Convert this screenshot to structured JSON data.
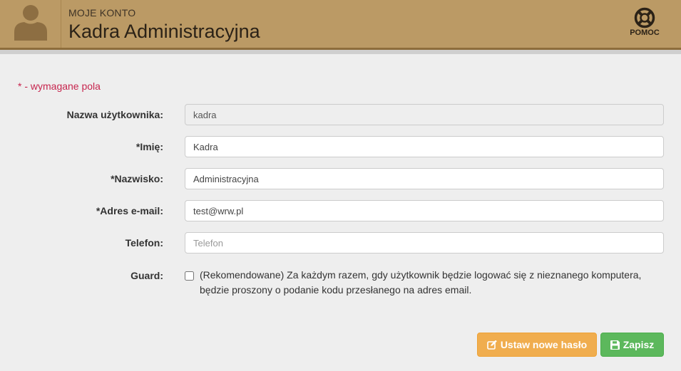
{
  "header": {
    "subtitle": "MOJE KONTO",
    "title": "Kadra Administracyjna",
    "help_label": "POMOC",
    "avatar_icon": "user-silhouette-icon",
    "help_icon": "lifebuoy-icon",
    "background_color": "#bb9a65"
  },
  "form": {
    "required_note": "* - wymagane pola",
    "username": {
      "label": "Nazwa użytkownika:",
      "value": "kadra",
      "readonly": true
    },
    "first_name": {
      "label": "*Imię:",
      "value": "Kadra"
    },
    "last_name": {
      "label": "*Nazwisko:",
      "value": "Administracyjna"
    },
    "email": {
      "label": "*Adres e-mail:",
      "value": "test@wrw.pl"
    },
    "phone": {
      "label": "Telefon:",
      "value": "",
      "placeholder": "Telefon"
    },
    "guard": {
      "label": "Guard:",
      "checked": false,
      "description": "(Rekomendowane) Za każdym razem, gdy użytkownik będzie logować się z nieznanego komputera, będzie proszony o podanie kodu przesłanego na adres email."
    }
  },
  "actions": {
    "set_password_label": "Ustaw nowe hasło",
    "set_password_icon": "edit-icon",
    "save_label": "Zapisz",
    "save_icon": "floppy-disk-icon",
    "orange": "#f0ad4e",
    "green": "#5cb85c"
  }
}
